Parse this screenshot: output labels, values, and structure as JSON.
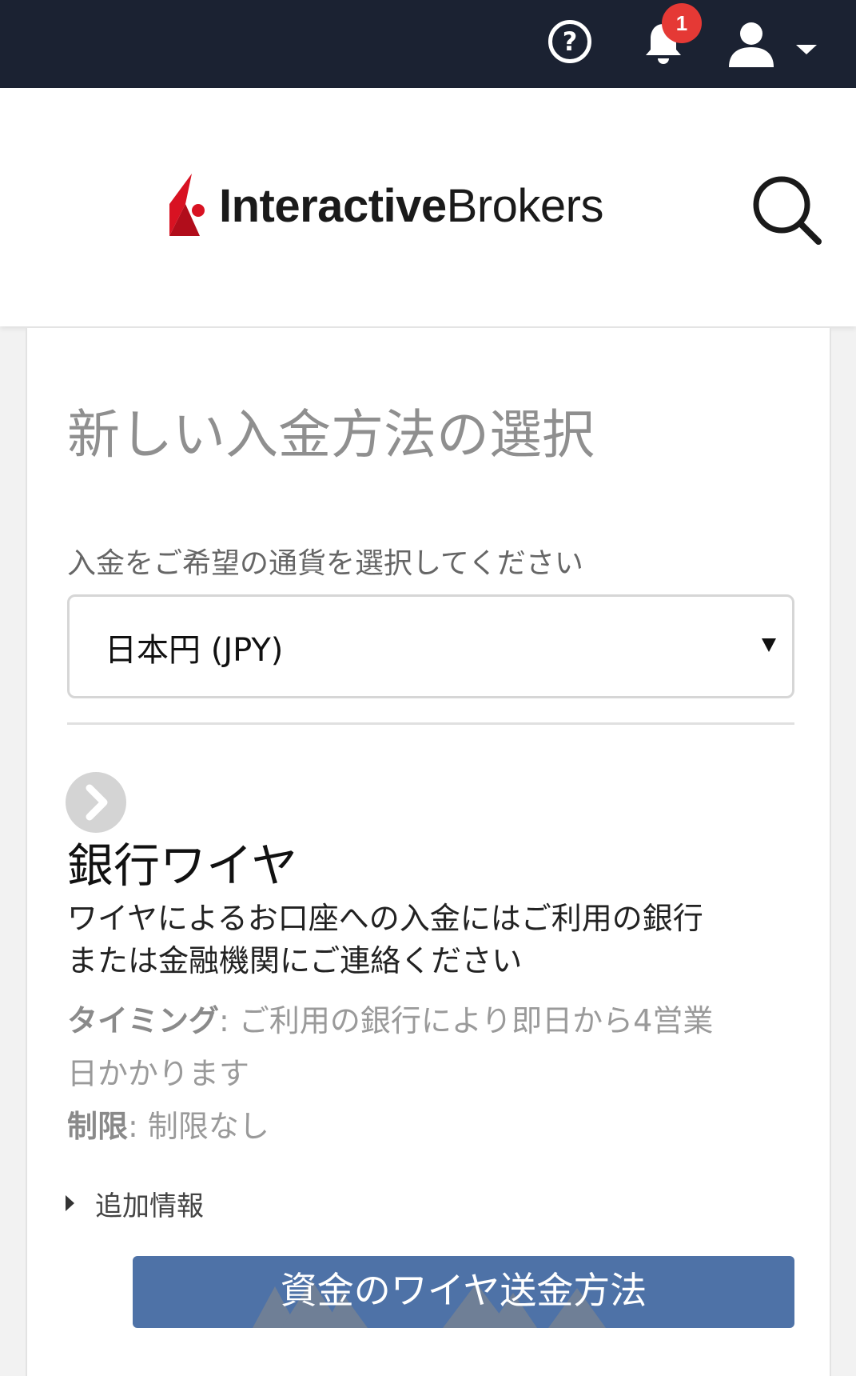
{
  "topbar": {
    "help_glyph": "?",
    "notification_count": "1",
    "icons": [
      "help-icon",
      "bell-icon",
      "user-icon",
      "caret-down-icon"
    ],
    "background_color": "#1b2232",
    "badge_color": "#e53935"
  },
  "header": {
    "logo_bold": "Interactive",
    "logo_regular": "Brokers",
    "icons": [
      "ib-logo-icon",
      "search-icon"
    ],
    "brand_color": "#d81222"
  },
  "main": {
    "title": "新しい入金方法の選択",
    "currency_label": "入金をご希望の通貨を選択してください",
    "currency_select": {
      "selected": "日本円 (JPY)"
    },
    "method": {
      "icon": "chevron-right-circle-icon",
      "title": "銀行ワイヤ",
      "description": "ワイヤによるお口座への入金にはご利用の銀行または金融機関にご連絡ください",
      "timing_label": "タイミング",
      "timing_value": ": ご利用の銀行により即日から4営業日かかります",
      "limit_label": "制限",
      "limit_value": ": 制限なし",
      "more_info": "追加情報",
      "button_label": "資金のワイヤ送金方法",
      "button_color": "#4e72a7"
    }
  }
}
